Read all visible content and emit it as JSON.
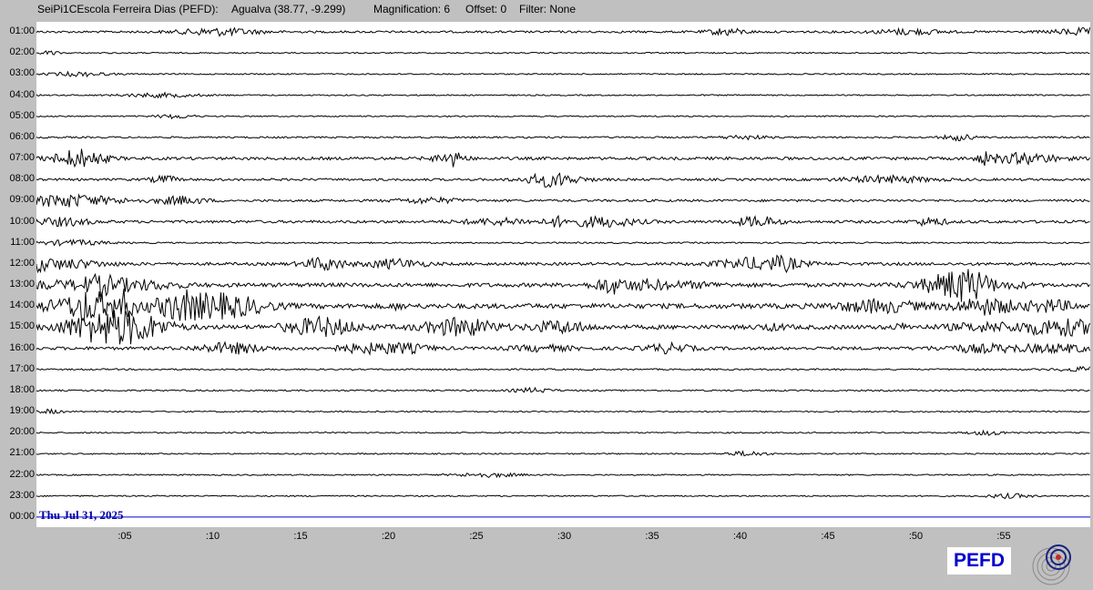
{
  "header": {
    "station": "SeiPi1CEscola Ferreira Dias (PEFD):",
    "location": "Agualva (38.77, -9.299)",
    "magnification": "Magnification: 6",
    "offset": "Offset: 0",
    "filter": "Filter: None"
  },
  "hours": [
    "01:00",
    "02:00",
    "03:00",
    "04:00",
    "05:00",
    "06:00",
    "07:00",
    "08:00",
    "09:00",
    "10:00",
    "11:00",
    "12:00",
    "13:00",
    "14:00",
    "15:00",
    "16:00",
    "17:00",
    "18:00",
    "19:00",
    "20:00",
    "21:00",
    "22:00",
    "23:00",
    "00:00"
  ],
  "minute_ticks": [
    ":05",
    ":10",
    ":15",
    ":20",
    ":25",
    ":30",
    ":35",
    ":40",
    ":45",
    ":50",
    ":55"
  ],
  "date_label": "Thu Jul 31, 2025",
  "logo_text": "PEFD",
  "trace_activity": [
    0.25,
    0.05,
    0.05,
    0.05,
    0.05,
    0.15,
    0.45,
    0.3,
    0.3,
    0.4,
    0.1,
    0.45,
    0.7,
    0.95,
    0.8,
    0.5,
    0.1,
    0.1,
    0.05,
    0.05,
    0.05,
    0.05,
    0.05,
    0
  ],
  "colors": {
    "trace": "#000000",
    "current_line": "#0000cc",
    "date": "#0000aa",
    "logo": "#0000cc"
  }
}
